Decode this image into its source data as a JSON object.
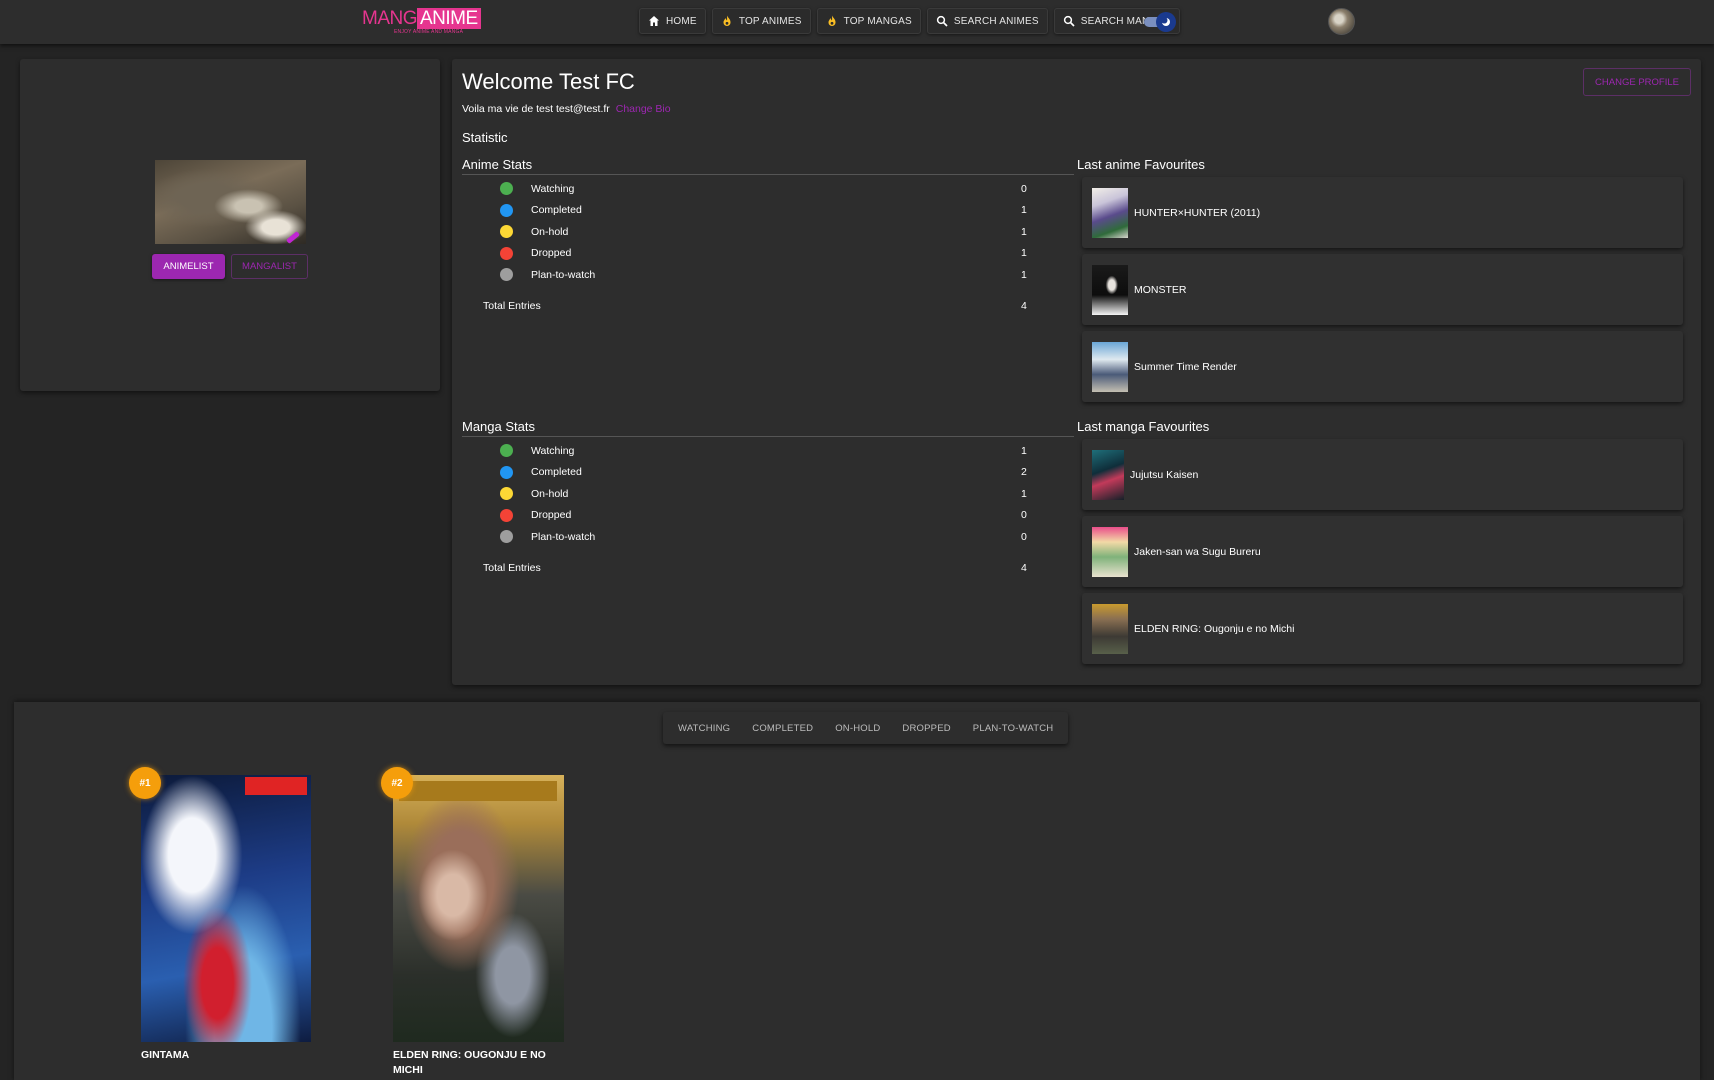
{
  "header": {
    "logo_word1": "MANG",
    "logo_word2": "ANIME",
    "logo_tagline": "ENJOY ANIME AND MANGA",
    "nav": [
      {
        "label": "HOME",
        "icon": "home-icon"
      },
      {
        "label": "TOP ANIMES",
        "icon": "fire-icon"
      },
      {
        "label": "TOP MANGAS",
        "icon": "fire-icon"
      },
      {
        "label": "SEARCH ANIMES",
        "icon": "search-icon"
      },
      {
        "label": "SEARCH MANGAS",
        "icon": "search-icon"
      }
    ]
  },
  "profile": {
    "animelist_label": "ANIMELIST",
    "mangalist_label": "MANGALIST"
  },
  "main": {
    "welcome": "Welcome Test FC",
    "bio": "Voila ma vie de test test@test.fr",
    "change_bio": "Change Bio",
    "change_profile": "CHANGE PROFILE",
    "statistic_title": "Statistic",
    "anime_stats": {
      "title": "Anime Stats",
      "rows": [
        {
          "label": "Watching",
          "value": "0",
          "color": "#4caf50"
        },
        {
          "label": "Completed",
          "value": "1",
          "color": "#2196f3"
        },
        {
          "label": "On-hold",
          "value": "1",
          "color": "#fdd835"
        },
        {
          "label": "Dropped",
          "value": "1",
          "color": "#f44336"
        },
        {
          "label": "Plan-to-watch",
          "value": "1",
          "color": "#9e9e9e"
        }
      ],
      "total_label": "Total Entries",
      "total_value": "4"
    },
    "manga_stats": {
      "title": "Manga Stats",
      "rows": [
        {
          "label": "Watching",
          "value": "1",
          "color": "#4caf50"
        },
        {
          "label": "Completed",
          "value": "2",
          "color": "#2196f3"
        },
        {
          "label": "On-hold",
          "value": "1",
          "color": "#fdd835"
        },
        {
          "label": "Dropped",
          "value": "0",
          "color": "#f44336"
        },
        {
          "label": "Plan-to-watch",
          "value": "0",
          "color": "#9e9e9e"
        }
      ],
      "total_label": "Total Entries",
      "total_value": "4"
    },
    "anime_favs": {
      "title": "Last anime Favourites",
      "items": [
        "HUNTER×HUNTER (2011)",
        "MONSTER",
        "Summer Time Render"
      ]
    },
    "manga_favs": {
      "title": "Last manga Favourites",
      "items": [
        "Jujutsu Kaisen",
        "Jaken-san wa Sugu Bureru",
        "ELDEN RING: Ougonju e no Michi"
      ]
    }
  },
  "list": {
    "tabs": [
      "WATCHING",
      "COMPLETED",
      "ON-HOLD",
      "DROPPED",
      "PLAN-TO-WATCH"
    ],
    "entries": [
      {
        "rank": "#1",
        "title": "GINTAMA"
      },
      {
        "rank": "#2",
        "title": "ELDEN RING: OUGONJU E NO MICHI"
      }
    ]
  },
  "colors": {
    "accent": "#9c27b0",
    "logo_pink": "#e6358f",
    "rank_badge": "#f59e0b",
    "background": "#242424",
    "card": "#2d2d2d"
  }
}
